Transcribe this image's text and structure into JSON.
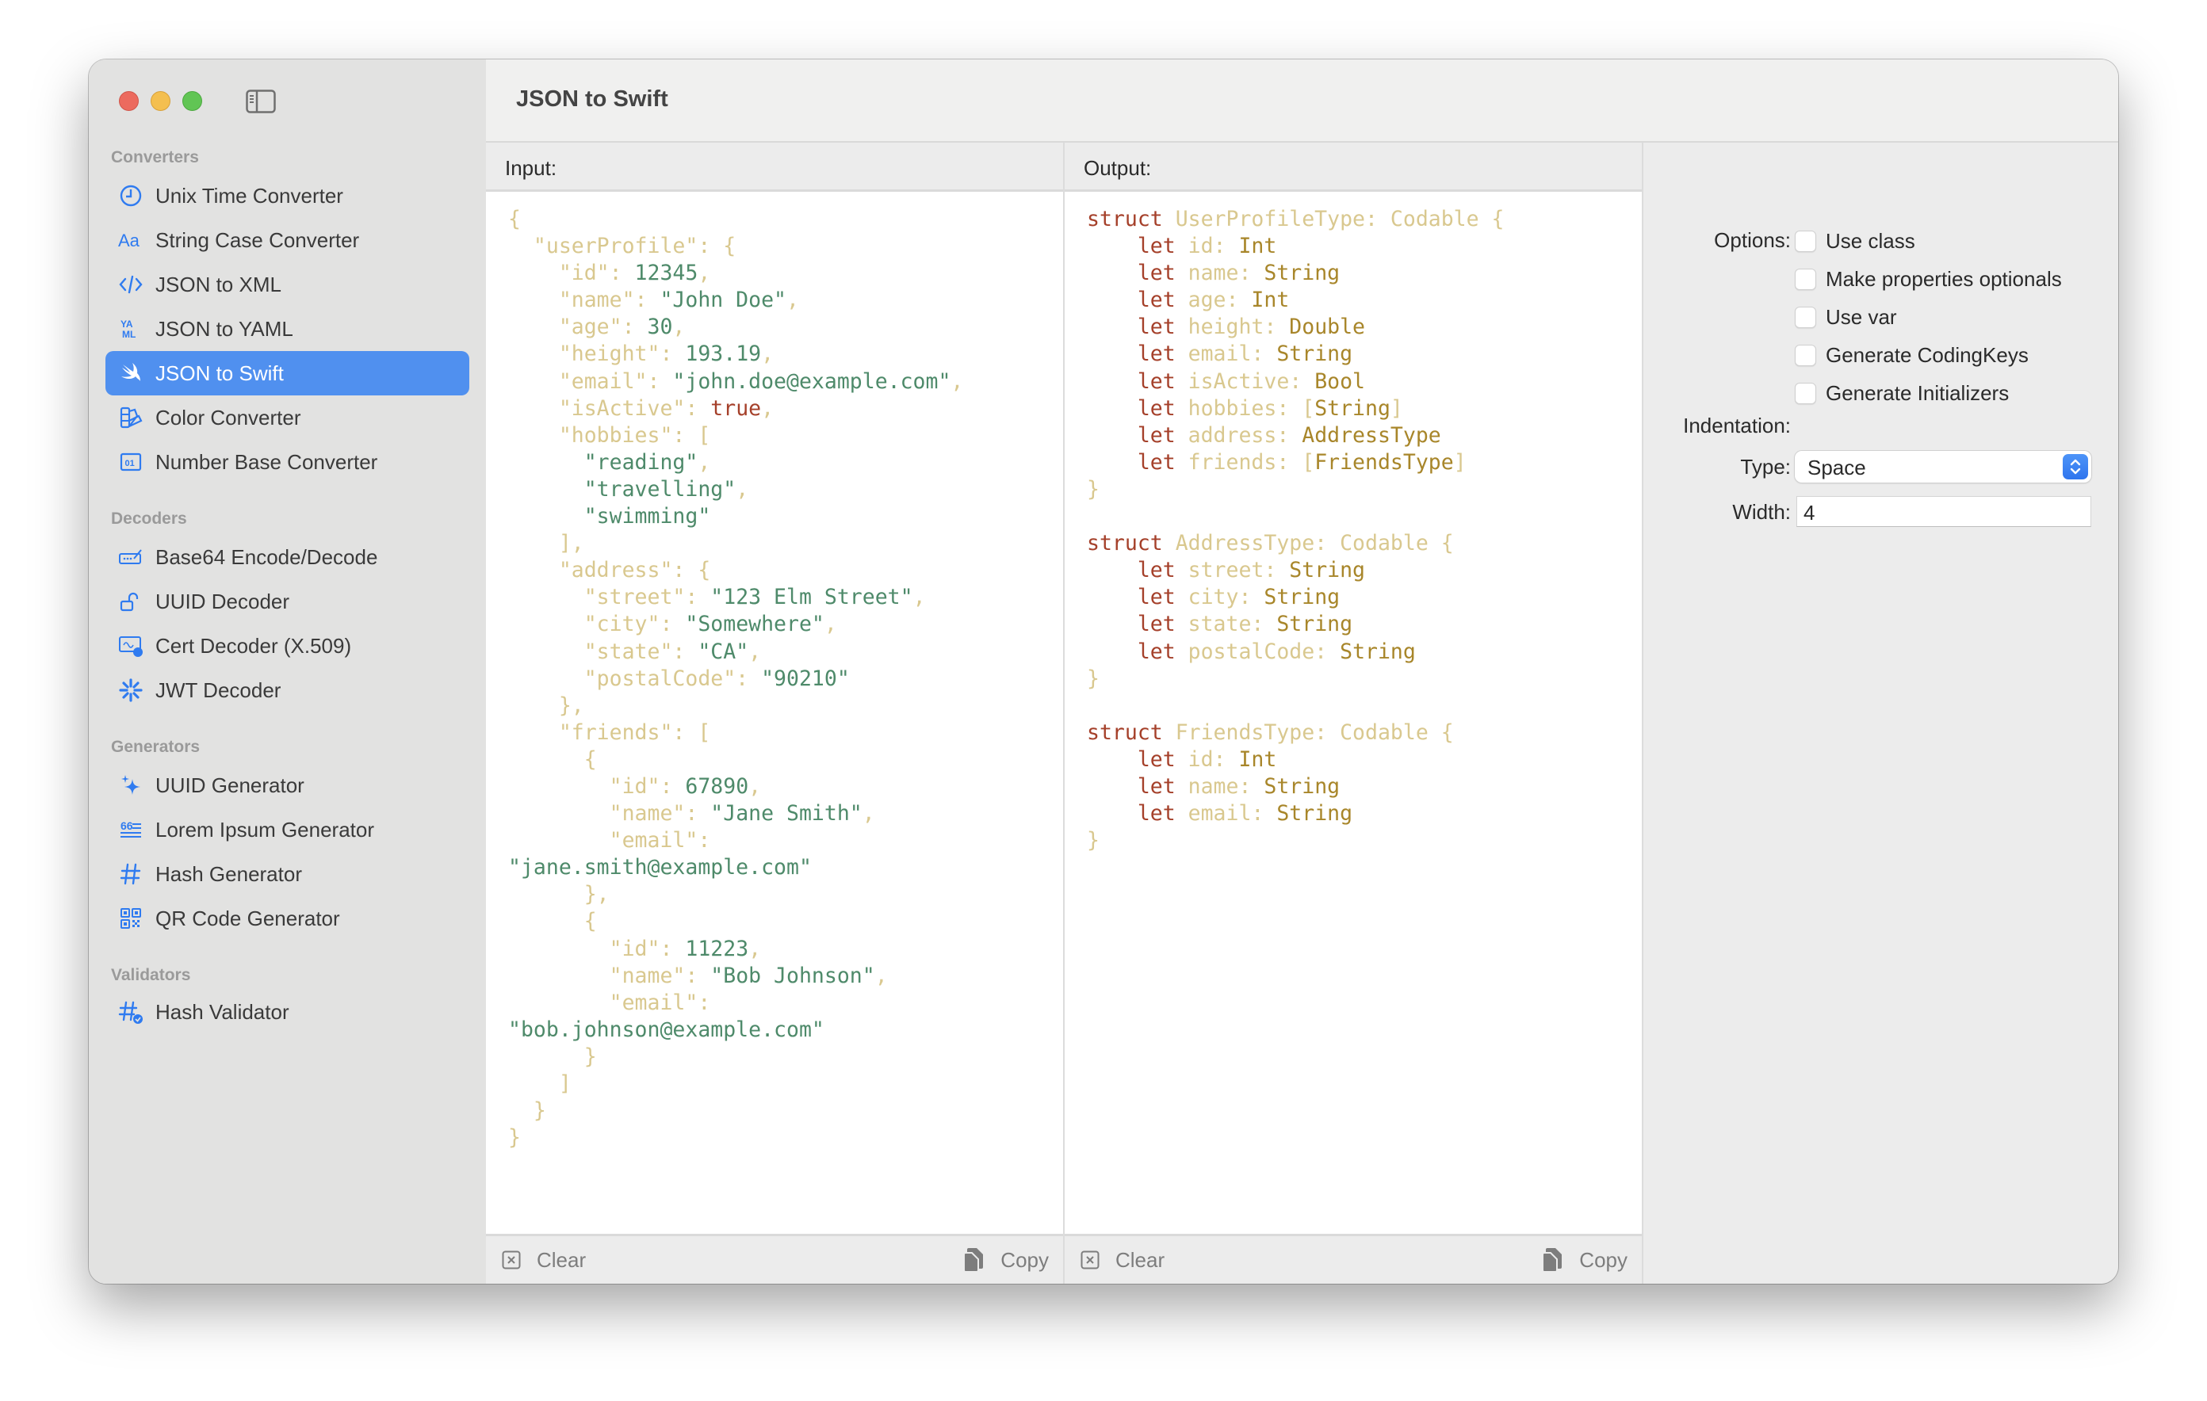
{
  "app": {
    "title": "JSON to Swift"
  },
  "sidebar": {
    "sections": [
      {
        "title": "Converters",
        "items": [
          {
            "label": "Unix Time Converter",
            "icon": "clock-icon"
          },
          {
            "label": "String Case Converter",
            "icon": "text-case-icon"
          },
          {
            "label": "JSON to XML",
            "icon": "code-brackets-icon"
          },
          {
            "label": "JSON to YAML",
            "icon": "yaml-icon"
          },
          {
            "label": "JSON to Swift",
            "icon": "swift-icon",
            "selected": true
          },
          {
            "label": "Color Converter",
            "icon": "swatchpalette-icon"
          },
          {
            "label": "Number Base Converter",
            "icon": "binary-01-icon"
          }
        ]
      },
      {
        "title": "Decoders",
        "items": [
          {
            "label": "Base64 Encode/Decode",
            "icon": "signature-field-icon"
          },
          {
            "label": "UUID Decoder",
            "icon": "lock-open-icon"
          },
          {
            "label": "Cert Decoder (X.509)",
            "icon": "certificate-icon"
          },
          {
            "label": "JWT Decoder",
            "icon": "asterisk-burst-icon"
          }
        ]
      },
      {
        "title": "Generators",
        "items": [
          {
            "label": "UUID Generator",
            "icon": "sparkles-icon"
          },
          {
            "label": "Lorem Ipsum Generator",
            "icon": "quote-lines-icon"
          },
          {
            "label": "Hash Generator",
            "icon": "hash-icon"
          },
          {
            "label": "QR Code Generator",
            "icon": "qrcode-icon"
          }
        ]
      },
      {
        "title": "Validators",
        "items": [
          {
            "label": "Hash Validator",
            "icon": "hash-check-icon"
          }
        ]
      }
    ]
  },
  "input": {
    "header": "Input:",
    "clear_label": "Clear",
    "copy_label": "Copy",
    "lines": [
      [
        [
          "k",
          "{"
        ]
      ],
      [
        [
          "k",
          "  \"userProfile\": {"
        ]
      ],
      [
        [
          "k",
          "    \"id\": "
        ],
        [
          "s",
          "12345"
        ],
        [
          "k",
          ","
        ]
      ],
      [
        [
          "k",
          "    \"name\": "
        ],
        [
          "s",
          "\"John Doe\""
        ],
        [
          "k",
          ","
        ]
      ],
      [
        [
          "k",
          "    \"age\": "
        ],
        [
          "s",
          "30"
        ],
        [
          "k",
          ","
        ]
      ],
      [
        [
          "k",
          "    \"height\": "
        ],
        [
          "s",
          "193.19"
        ],
        [
          "k",
          ","
        ]
      ],
      [
        [
          "k",
          "    \"email\": "
        ],
        [
          "s",
          "\"john.doe@example.com\""
        ],
        [
          "k",
          ","
        ]
      ],
      [
        [
          "k",
          "    \"isActive\": "
        ],
        [
          "b",
          "true"
        ],
        [
          "k",
          ","
        ]
      ],
      [
        [
          "k",
          "    \"hobbies\": ["
        ]
      ],
      [
        [
          "s",
          "      \"reading\""
        ],
        [
          "k",
          ","
        ]
      ],
      [
        [
          "s",
          "      \"travelling\""
        ],
        [
          "k",
          ","
        ]
      ],
      [
        [
          "s",
          "      \"swimming\""
        ]
      ],
      [
        [
          "k",
          "    ],"
        ]
      ],
      [
        [
          "k",
          "    \"address\": {"
        ]
      ],
      [
        [
          "k",
          "      \"street\": "
        ],
        [
          "s",
          "\"123 Elm Street\""
        ],
        [
          "k",
          ","
        ]
      ],
      [
        [
          "k",
          "      \"city\": "
        ],
        [
          "s",
          "\"Somewhere\""
        ],
        [
          "k",
          ","
        ]
      ],
      [
        [
          "k",
          "      \"state\": "
        ],
        [
          "s",
          "\"CA\""
        ],
        [
          "k",
          ","
        ]
      ],
      [
        [
          "k",
          "      \"postalCode\": "
        ],
        [
          "s",
          "\"90210\""
        ]
      ],
      [
        [
          "k",
          "    },"
        ]
      ],
      [
        [
          "k",
          "    \"friends\": ["
        ]
      ],
      [
        [
          "k",
          "      {"
        ]
      ],
      [
        [
          "k",
          "        \"id\": "
        ],
        [
          "s",
          "67890"
        ],
        [
          "k",
          ","
        ]
      ],
      [
        [
          "k",
          "        \"name\": "
        ],
        [
          "s",
          "\"Jane Smith\""
        ],
        [
          "k",
          ","
        ]
      ],
      [
        [
          "k",
          "        \"email\":"
        ]
      ],
      [
        [
          "s",
          "\"jane.smith@example.com\""
        ]
      ],
      [
        [
          "k",
          "      },"
        ]
      ],
      [
        [
          "k",
          "      {"
        ]
      ],
      [
        [
          "k",
          "        \"id\": "
        ],
        [
          "s",
          "11223"
        ],
        [
          "k",
          ","
        ]
      ],
      [
        [
          "k",
          "        \"name\": "
        ],
        [
          "s",
          "\"Bob Johnson\""
        ],
        [
          "k",
          ","
        ]
      ],
      [
        [
          "k",
          "        \"email\":"
        ]
      ],
      [
        [
          "s",
          "\"bob.johnson@example.com\""
        ]
      ],
      [
        [
          "k",
          "      }"
        ]
      ],
      [
        [
          "k",
          "    ]"
        ]
      ],
      [
        [
          "k",
          "  }"
        ]
      ],
      [
        [
          "k",
          "}"
        ]
      ]
    ]
  },
  "output": {
    "header": "Output:",
    "clear_label": "Clear",
    "copy_label": "Copy",
    "lines": [
      [
        [
          "b",
          "struct"
        ],
        [
          "k",
          " UserProfileType: Codable {"
        ]
      ],
      [
        [
          "b",
          "    let"
        ],
        [
          "k",
          " id: "
        ],
        [
          "t",
          "Int"
        ]
      ],
      [
        [
          "b",
          "    let"
        ],
        [
          "k",
          " name: "
        ],
        [
          "t",
          "String"
        ]
      ],
      [
        [
          "b",
          "    let"
        ],
        [
          "k",
          " age: "
        ],
        [
          "t",
          "Int"
        ]
      ],
      [
        [
          "b",
          "    let"
        ],
        [
          "k",
          " height: "
        ],
        [
          "t",
          "Double"
        ]
      ],
      [
        [
          "b",
          "    let"
        ],
        [
          "k",
          " email: "
        ],
        [
          "t",
          "String"
        ]
      ],
      [
        [
          "b",
          "    let"
        ],
        [
          "k",
          " isActive: "
        ],
        [
          "t",
          "Bool"
        ]
      ],
      [
        [
          "b",
          "    let"
        ],
        [
          "k",
          " hobbies: ["
        ],
        [
          "t",
          "String"
        ],
        [
          "k",
          "]"
        ]
      ],
      [
        [
          "b",
          "    let"
        ],
        [
          "k",
          " address: "
        ],
        [
          "t",
          "AddressType"
        ]
      ],
      [
        [
          "b",
          "    let"
        ],
        [
          "k",
          " friends: ["
        ],
        [
          "t",
          "FriendsType"
        ],
        [
          "k",
          "]"
        ]
      ],
      [
        [
          "k",
          "}"
        ]
      ],
      [
        [
          "k",
          ""
        ]
      ],
      [
        [
          "b",
          "struct"
        ],
        [
          "k",
          " AddressType: Codable {"
        ]
      ],
      [
        [
          "b",
          "    let"
        ],
        [
          "k",
          " street: "
        ],
        [
          "t",
          "String"
        ]
      ],
      [
        [
          "b",
          "    let"
        ],
        [
          "k",
          " city: "
        ],
        [
          "t",
          "String"
        ]
      ],
      [
        [
          "b",
          "    let"
        ],
        [
          "k",
          " state: "
        ],
        [
          "t",
          "String"
        ]
      ],
      [
        [
          "b",
          "    let"
        ],
        [
          "k",
          " postalCode: "
        ],
        [
          "t",
          "String"
        ]
      ],
      [
        [
          "k",
          "}"
        ]
      ],
      [
        [
          "k",
          ""
        ]
      ],
      [
        [
          "b",
          "struct"
        ],
        [
          "k",
          " FriendsType: Codable {"
        ]
      ],
      [
        [
          "b",
          "    let"
        ],
        [
          "k",
          " id: "
        ],
        [
          "t",
          "Int"
        ]
      ],
      [
        [
          "b",
          "    let"
        ],
        [
          "k",
          " name: "
        ],
        [
          "t",
          "String"
        ]
      ],
      [
        [
          "b",
          "    let"
        ],
        [
          "k",
          " email: "
        ],
        [
          "t",
          "String"
        ]
      ],
      [
        [
          "k",
          "}"
        ]
      ]
    ]
  },
  "options": {
    "options_label": "Options:",
    "checkboxes": [
      {
        "label": "Use class",
        "checked": false
      },
      {
        "label": "Make properties optionals",
        "checked": false
      },
      {
        "label": "Use var",
        "checked": false
      },
      {
        "label": "Generate CodingKeys",
        "checked": false
      },
      {
        "label": "Generate Initializers",
        "checked": false
      }
    ],
    "indentation_label": "Indentation:",
    "type_label": "Type:",
    "type_value": "Space",
    "width_label": "Width:",
    "width_value": "4"
  },
  "colors": {
    "accent": "#5090ef",
    "icon_blue": "#2f7bf0",
    "json_key": "#d9c88f",
    "json_value": "#4e8a6a",
    "keyword": "#a5402a",
    "type": "#a8862a"
  }
}
